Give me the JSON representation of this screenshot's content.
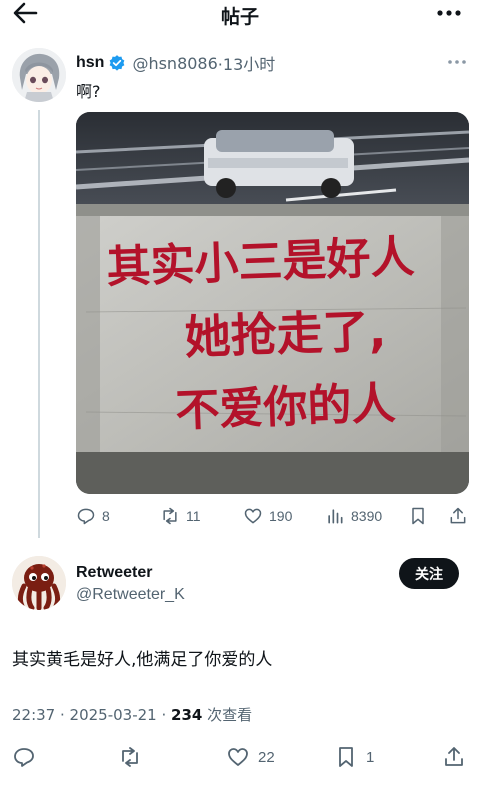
{
  "header": {
    "title": "帖子"
  },
  "post": {
    "display_name": "hsn",
    "handle": "@hsn8086",
    "time": "·13小时",
    "text": "啊?",
    "image_text": [
      "其实小三是好人",
      "她抢走了,",
      "不爱你的人"
    ],
    "stats": {
      "replies": "8",
      "retweets": "11",
      "likes": "190",
      "views": "8390"
    }
  },
  "reply": {
    "display_name": "Retweeter",
    "handle": "@Retweeter_K",
    "follow_label": "关注",
    "text": "其实黄毛是好人,他满足了你爱的人",
    "timestamp": "22:37 · 2025-03-21 · ",
    "views": "234",
    "views_label": " 次查看",
    "stats": {
      "likes": "22",
      "bookmarks": "1"
    }
  },
  "colors": {
    "text": "#0f1419",
    "muted": "#536471",
    "verified": "#1d9bf0",
    "graffiti": "#b3122a"
  }
}
